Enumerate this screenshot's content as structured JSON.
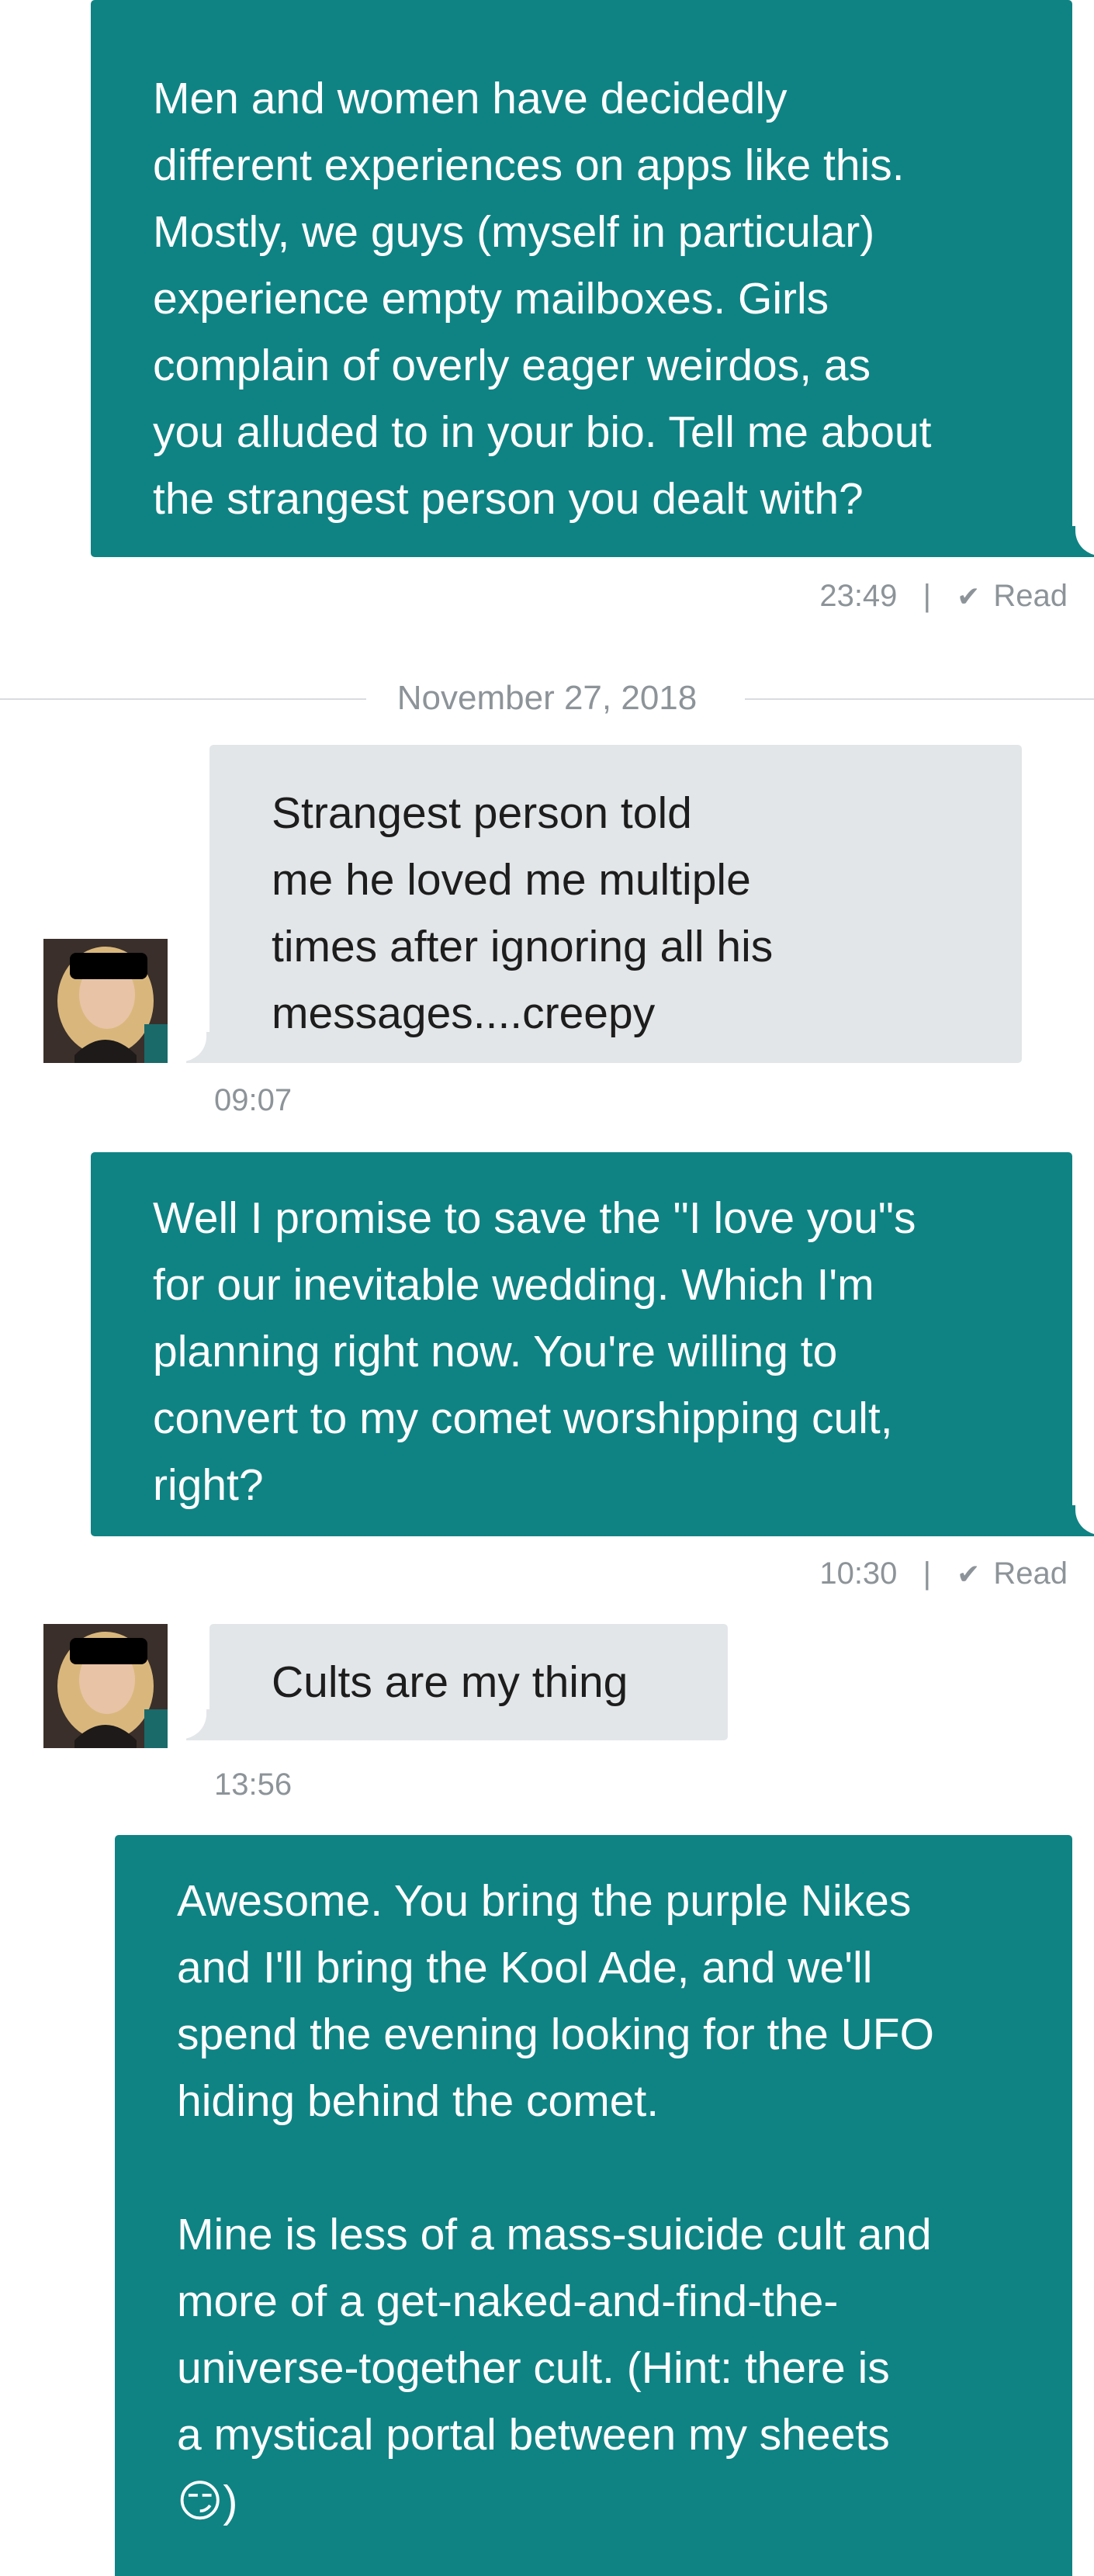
{
  "conversation": {
    "messages": [
      {
        "direction": "outgoing",
        "text": "Men and women have decidedly\ndifferent experiences on apps like this.\nMostly, we guys (myself in particular)\nexperience empty mailboxes. Girls\ncomplain of overly eager weirdos, as\nyou alluded to in your bio. Tell me about\nthe strangest person you dealt with?",
        "time": "23:49",
        "status": "Read"
      },
      {
        "direction": "incoming",
        "text": "Strangest person told\nme he loved me multiple\ntimes after ignoring all his\nmessages....creepy",
        "time": "09:07"
      },
      {
        "direction": "outgoing",
        "text": "Well I promise to save the \"I love you\"s\nfor our inevitable wedding. Which I'm\nplanning right now. You're willing to\nconvert to my comet worshipping cult,\nright?",
        "time": "10:30",
        "status": "Read"
      },
      {
        "direction": "incoming",
        "text": "Cults are my thing",
        "time": "13:56"
      },
      {
        "direction": "outgoing",
        "text": "Awesome. You bring the purple Nikes\nand I'll bring the Kool Ade, and we'll\nspend the evening looking for the UFO\nhiding behind the comet.\n\nMine is less of a mass-suicide cult and\nmore of a get-naked-and-find-the-\nuniverse-together cult. (Hint: there is\na mystical portal between my sheets\n😏)"
      }
    ],
    "date_divider": "November 27, 2018",
    "separator": "|",
    "read_icon": "checkmark-icon",
    "colors": {
      "outgoing_bubble": "#0f8384",
      "incoming_bubble": "#e3e6e8",
      "meta_text": "#8d9499"
    }
  }
}
